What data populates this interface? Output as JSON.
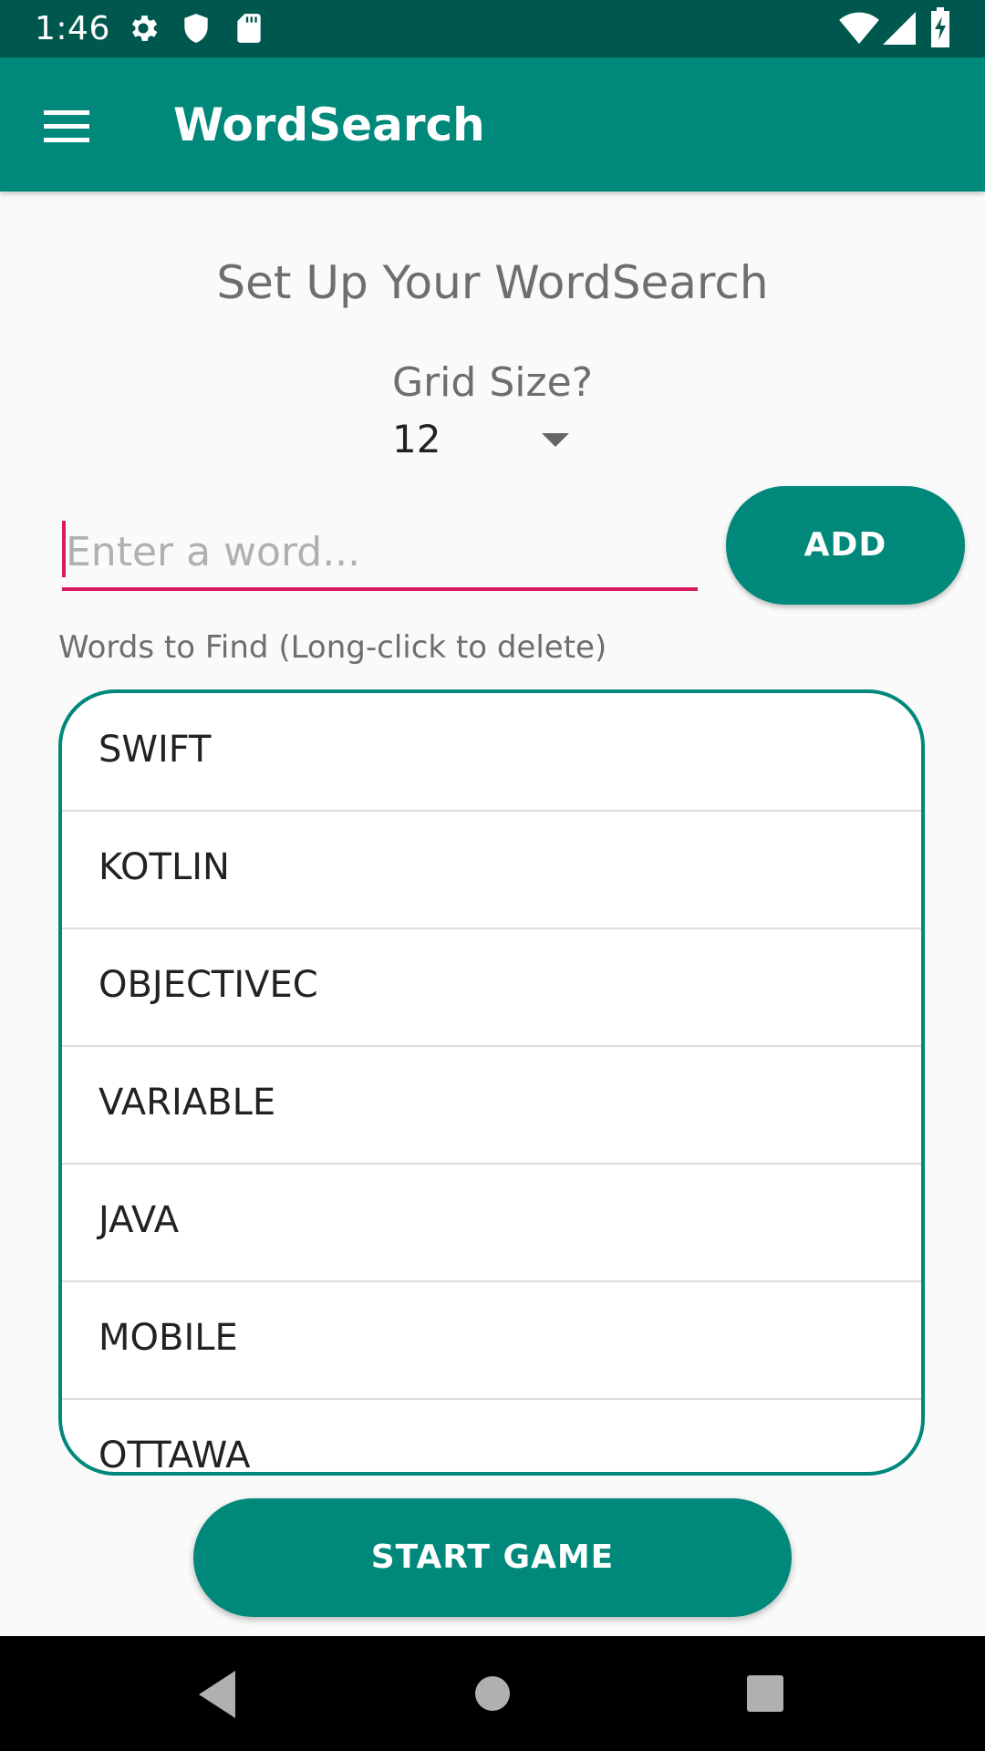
{
  "status_bar": {
    "time": "1:46",
    "left_icons": [
      "gear-icon",
      "shield-icon",
      "sd-card-icon"
    ],
    "right_icons": [
      "wifi-icon",
      "signal-icon",
      "battery-charging-icon"
    ]
  },
  "app_bar": {
    "title": "WordSearch",
    "menu_icon": "hamburger-menu-icon"
  },
  "setup": {
    "heading": "Set Up Your WordSearch",
    "grid_size_label": "Grid Size?",
    "grid_size_value": "12",
    "word_input_placeholder": "Enter a word...",
    "word_input_value": "",
    "add_label": "ADD",
    "list_label": "Words to Find (Long-click to delete)",
    "words": [
      "SWIFT",
      "KOTLIN",
      "OBJECTIVEC",
      "VARIABLE",
      "JAVA",
      "MOBILE",
      "OTTAWA"
    ],
    "start_label": "START GAME"
  },
  "nav_bar": {
    "icons": [
      "back-icon",
      "home-icon",
      "recents-icon"
    ]
  },
  "colors": {
    "primary": "#00897b",
    "primary_dark": "#00574e",
    "accent": "#d81b60"
  }
}
